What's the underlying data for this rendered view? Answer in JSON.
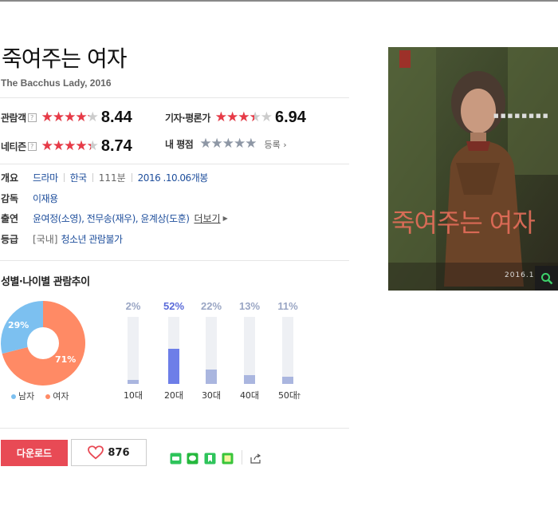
{
  "movie": {
    "title": "죽여주는 여자",
    "subtitle": "The Bacchus Lady, 2016"
  },
  "ratings": {
    "audience": {
      "label": "관람객",
      "help": "?",
      "score": "8.44",
      "fraction": 0.844
    },
    "critics": {
      "label": "기자·평론가",
      "score": "6.94",
      "fraction": 0.694
    },
    "netizen": {
      "label": "네티즌",
      "help": "?",
      "score": "8.74",
      "fraction": 0.874
    },
    "my": {
      "label": "내 평점",
      "action": "등록"
    }
  },
  "info": {
    "overview_label": "개요",
    "genre": "드라마",
    "country": "한국",
    "runtime": "111분",
    "release": "2016 .10.06개봉",
    "director_label": "감독",
    "director": "이재용",
    "cast_label": "출연",
    "cast": "윤여정(소영), 전무송(재우), 윤계상(도훈)",
    "cast_more": "더보기",
    "grade_label": "등급",
    "grade_prefix": "[국내]",
    "grade": "청소년 관람불가"
  },
  "stats": {
    "section_title": "성별·나이별 관람추이",
    "gender": {
      "male_label": "남자",
      "female_label": "여자",
      "male_pct_text": "29%",
      "female_pct_text": "71%",
      "male": 29,
      "female": 71,
      "male_color": "#7cc0f0",
      "female_color": "#ff8a65"
    },
    "ages": [
      {
        "label": "10대",
        "pct_text": "2%",
        "value": 2
      },
      {
        "label": "20대",
        "pct_text": "52%",
        "value": 52,
        "highlight": true
      },
      {
        "label": "30대",
        "pct_text": "22%",
        "value": 22
      },
      {
        "label": "40대",
        "pct_text": "13%",
        "value": 13
      },
      {
        "label": "50대",
        "pct_text": "11%",
        "value": 11
      }
    ]
  },
  "actions": {
    "download_label": "다운로드",
    "like_count": "876"
  },
  "share_icons": [
    "band-icon",
    "line-icon",
    "bookmark-icon",
    "memo-icon",
    "share-out-icon"
  ],
  "poster": {
    "title_text": "죽여주는 여자",
    "date_text": "2016.1"
  },
  "colors": {
    "accent_red": "#e84a55",
    "star_red": "#e83a47",
    "link_blue": "#1f4f9c",
    "age_highlight": "#6d7ee8"
  }
}
